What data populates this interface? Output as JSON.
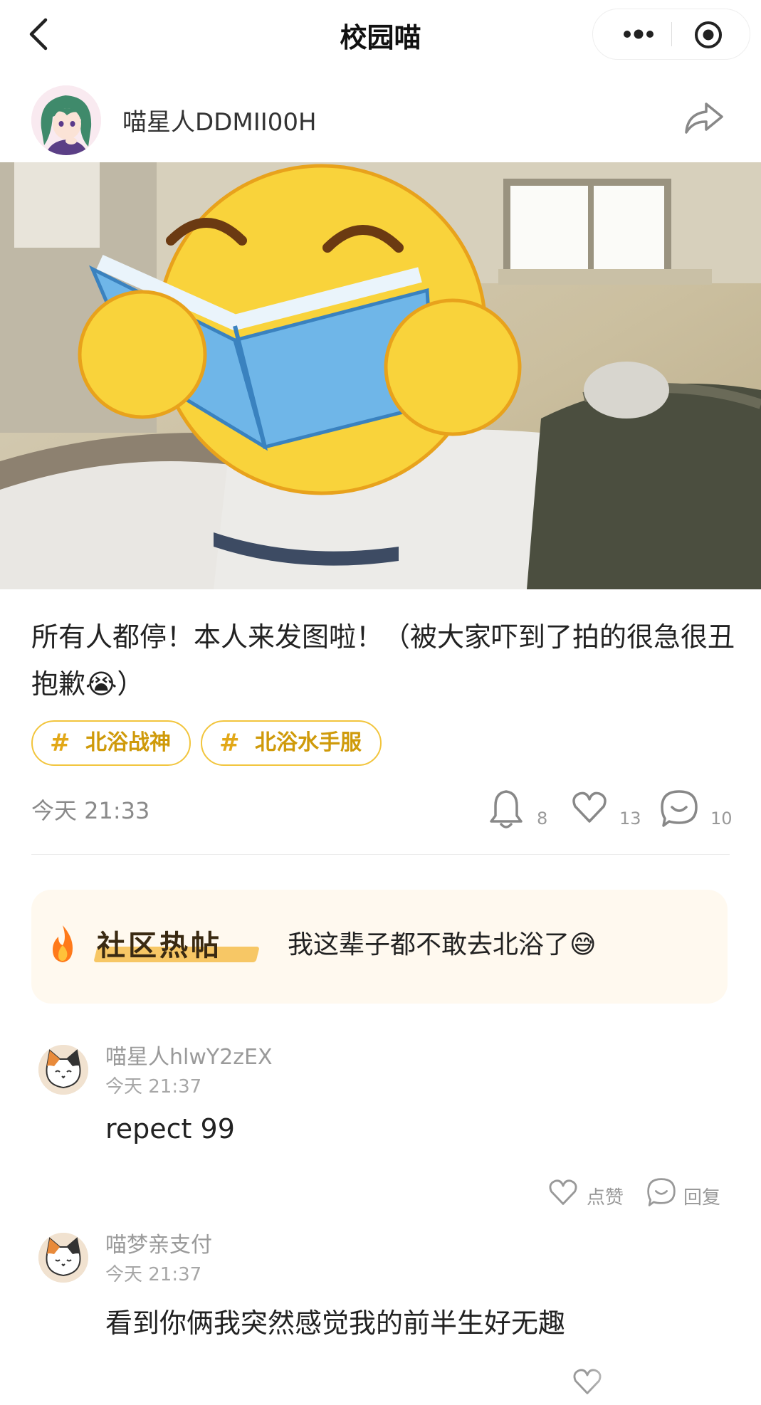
{
  "topbar": {
    "title": "校园喵",
    "back_icon": "chevron-left-icon",
    "more_icon": "more-dots-icon",
    "close_icon": "target-close-icon"
  },
  "post": {
    "author": "喵星人DDMII00H",
    "text": "所有人都停！本人来发图啦！（被大家吓到了拍的很急很丑抱歉😭）",
    "tags": [
      {
        "label": "北浴战神"
      },
      {
        "label": "北浴水手服"
      }
    ],
    "time": "今天 21:33",
    "stats": {
      "notify_count": "8",
      "likes": "13",
      "comments": "10"
    },
    "photo_overlay": "reading-emoji-sticker"
  },
  "hot": {
    "label": "社区热帖",
    "title": "我这辈子都不敢去北浴了😅"
  },
  "comments": [
    {
      "user": "喵星人hlwY2zEX",
      "time": "今天 21:37",
      "text": "repect 99",
      "like_label": "点赞",
      "reply_label": "回复"
    },
    {
      "user": "喵梦亲支付",
      "time": "今天 21:37",
      "text": "看到你俩我突然感觉我的前半生好无趣"
    }
  ],
  "colors": {
    "accent": "#f2c53d",
    "tag_text": "#cf9a0a",
    "hot_bg": "#fff9ef"
  }
}
